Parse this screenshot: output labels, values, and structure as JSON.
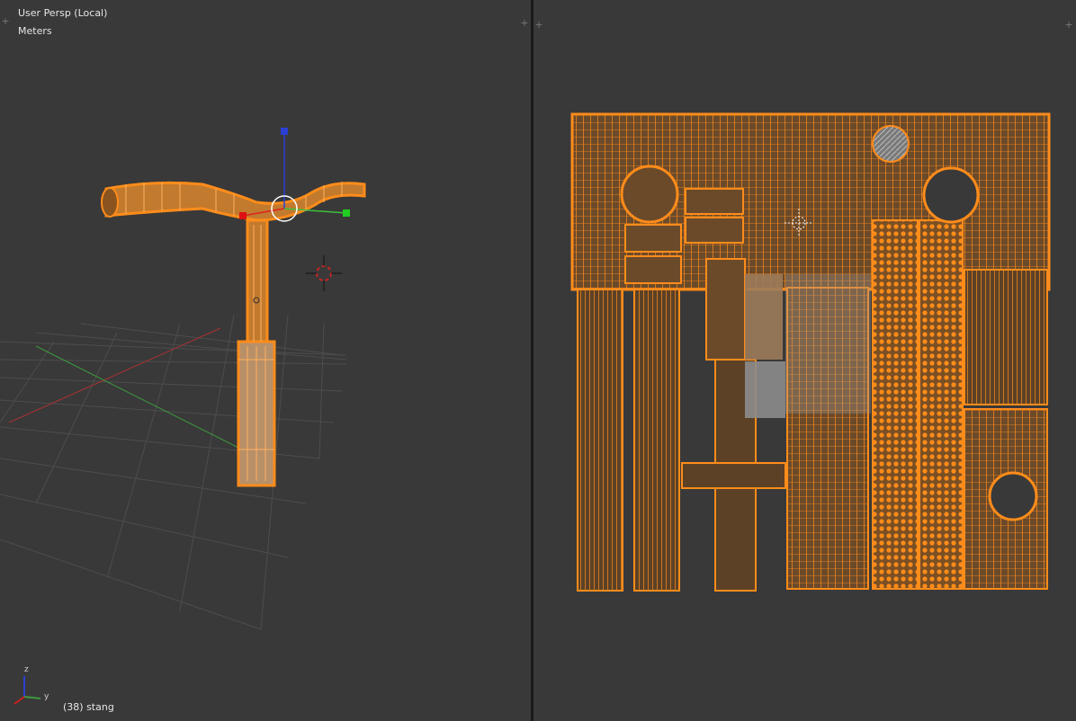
{
  "viewport_3d": {
    "view_name": "User Persp (Local)",
    "units": "Meters",
    "object_info": "(38) stang",
    "axis_labels": {
      "z": "z",
      "y": "y"
    },
    "icons": {
      "corner_widget": "plus-icon",
      "cursor": "3d-cursor-icon",
      "manipulator": "transform-manipulator-icon",
      "axis_gizmo": "axis-gizmo-icon"
    }
  },
  "viewport_uv": {
    "icons": {
      "corner_widget": "plus-icon",
      "cursor": "2d-cursor-icon"
    }
  },
  "colors": {
    "background": "#393939",
    "selection_orange": "#ff8c1a",
    "face_fill": "#6b4a2a",
    "grid": "#4a4a4a",
    "axis_x": "#a83232",
    "axis_y": "#3d9a3d",
    "axis_z": "#2a3fd4"
  }
}
